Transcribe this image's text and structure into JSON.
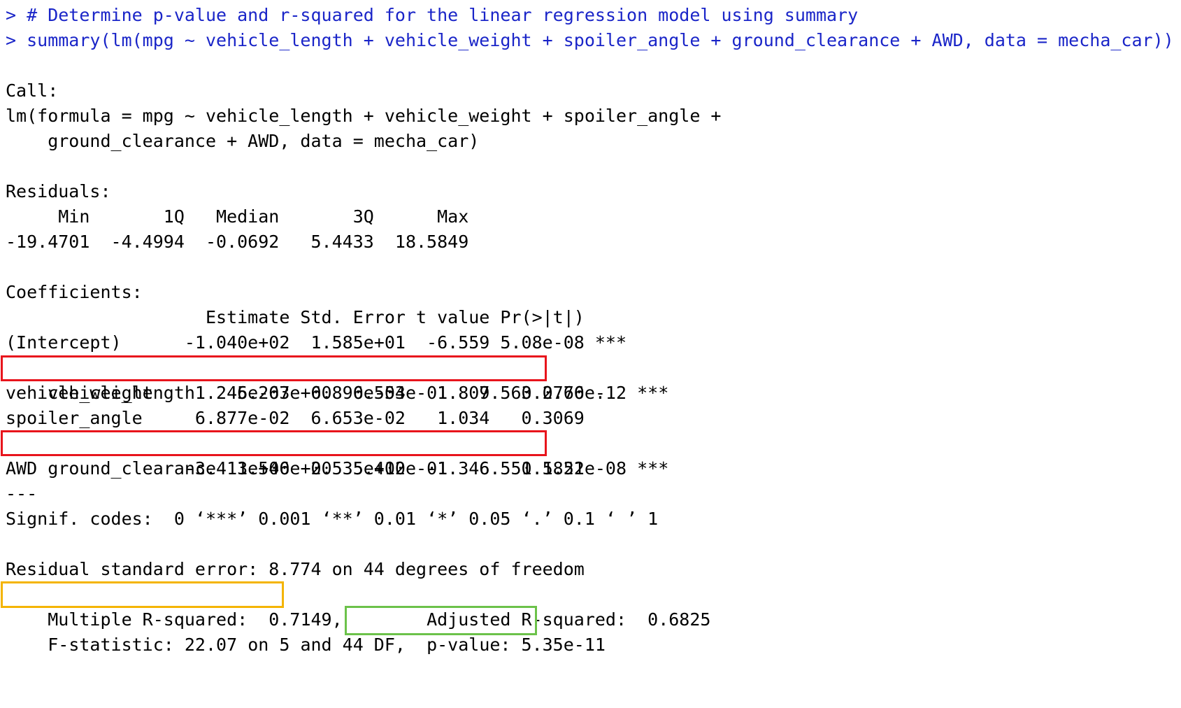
{
  "console": {
    "input_lines": [
      "> # Determine p-value and r-squared for the linear regression model using summary",
      "> summary(lm(mpg ~ vehicle_length + vehicle_weight + spoiler_angle + ground_clearance + AWD, data = mecha_car))"
    ],
    "call_header": "Call:",
    "call_lines": [
      "lm(formula = mpg ~ vehicle_length + vehicle_weight + spoiler_angle + ",
      "    ground_clearance + AWD, data = mecha_car)"
    ],
    "residuals_header": "Residuals:",
    "residuals_labels": "     Min       1Q   Median       3Q      Max ",
    "residuals_values": "-19.4701  -4.4994  -0.0692   5.4433  18.5849 ",
    "coefficients_header": "Coefficients:",
    "coefficients_columns": "                   Estimate Std. Error t value Pr(>|t|)    ",
    "coefficient_rows": [
      "(Intercept)      -1.040e+02  1.585e+01  -6.559 5.08e-08 ***",
      "vehicle_length    6.267e+00  6.553e-01   9.563 2.60e-12 ***",
      "vehicle_weight    1.245e-03  6.890e-04   1.807   0.0776 .  ",
      "spoiler_angle     6.877e-02  6.653e-02   1.034   0.3069    ",
      "ground_clearance  3.546e+00  5.412e-01   6.551 5.21e-08 ***",
      "AWD              -3.411e+00  2.535e+00  -1.346   0.1852    "
    ],
    "separator": "---",
    "signif_codes": "Signif. codes:  0 ‘***’ 0.001 ‘**’ 0.01 ‘*’ 0.05 ‘.’ 0.1 ‘ ’ 1",
    "residual_std_error": "Residual standard error: 8.774 on 44 degrees of freedom",
    "r_squared": "Multiple R-squared:  0.7149,\tAdjusted R-squared:  0.6825 ",
    "f_statistic": "F-statistic: 22.07 on 5 and 44 DF,  p-value: 5.35e-11"
  },
  "highlight_colors": {
    "coefficient_rows": "#e8141c",
    "multiple_r_squared": "#f4b400",
    "p_value": "#6cc24a"
  }
}
